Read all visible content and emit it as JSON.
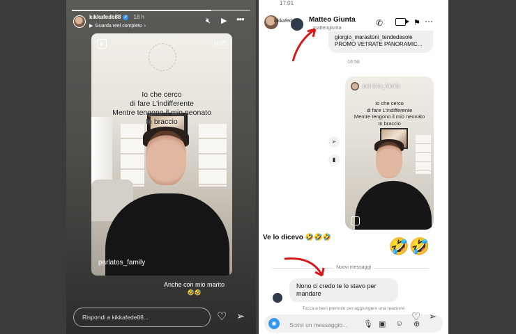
{
  "story": {
    "username": "kikkafede88",
    "time": "18 h",
    "subline": "Guarda reel completo",
    "duration": "0:05",
    "overlay_text": "Io che cerco\ndi fare L'indifferente\nMentre tengono il mio neonato\nIn braccio",
    "tag": "parlatos_family",
    "caption_line1": "Anche con mio marito",
    "caption_emoji": "🤣🤣",
    "reply_placeholder": "Rispondi a kikkafede88...",
    "icons": [
      "mute-icon",
      "play-icon",
      "more-icon",
      "heart-icon",
      "send-icon"
    ]
  },
  "dm": {
    "status_time": "17:01",
    "back_label": "kikkafede88",
    "peer_name": "Matteo Giunta",
    "peer_handle": "matteogiunta",
    "prev_message": "giorgio_marastoni_tendedasole\nPROMO VETRATE PANORAMIC...",
    "timestamp": "16:58",
    "shared_reel": {
      "account": "parlatos_family",
      "overlay_text": "Io che cerco\ndi fare L'indifferente\nMentre tengono il mio neonato\nIn braccio"
    },
    "message_left": "Ve lo dicevo 🤣🤣🤣",
    "emoji_reply": "🤣🤣",
    "new_messages_label": "Nuovi messaggi",
    "incoming_message": "Nono ci credo te lo stavo per mandare",
    "hint": "Tocca e tieni premuto per aggiungere una reazione",
    "composer_placeholder": "Scrivi un messaggio...",
    "accent_color": "#3797f0"
  }
}
